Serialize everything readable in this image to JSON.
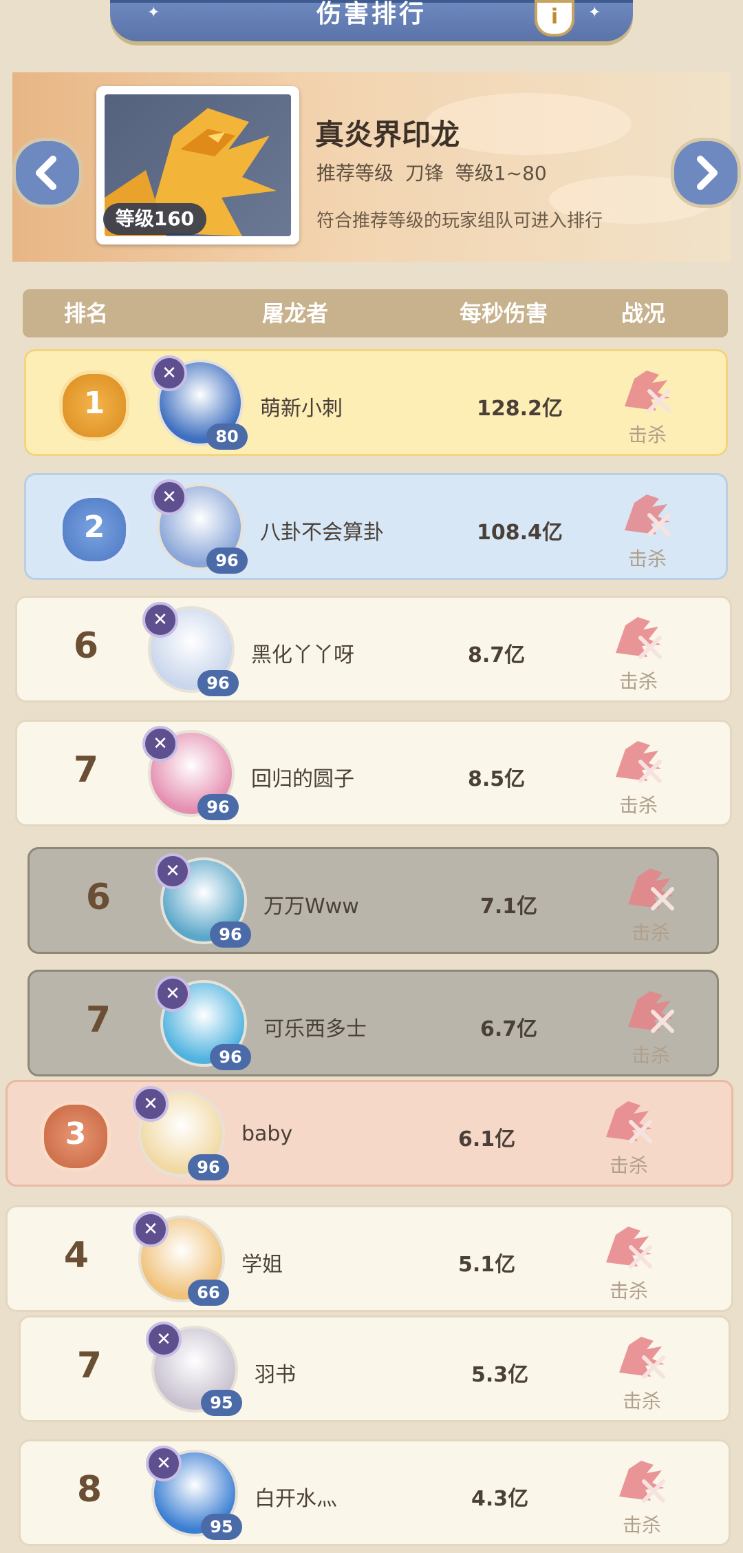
{
  "header": {
    "title": "伤害排行",
    "info_label": "i"
  },
  "boss": {
    "name": "真炎界印龙",
    "level_badge": "等级160",
    "subtitle": "推荐等级 刀锋  等级1~80",
    "rule": "符合推荐等级的玩家组队可进入排行",
    "prev_label": "<",
    "next_label": ">"
  },
  "columns": {
    "rank": "排名",
    "slayer": "屠龙者",
    "dps": "每秒伤害",
    "status": "战况"
  },
  "rows": [
    {
      "rank": "1",
      "medal": "gold",
      "name": "萌新小刺",
      "level": "80",
      "damage": "128.2亿",
      "status": "击杀",
      "avatar_color": "#3e6fc0"
    },
    {
      "rank": "2",
      "medal": "silver",
      "name": "八卦不会算卦",
      "level": "96",
      "damage": "108.4亿",
      "status": "击杀",
      "avatar_color": "#8aa6d8"
    },
    {
      "rank": "6",
      "medal": "",
      "name": "黑化丫丫呀",
      "level": "96",
      "damage": "8.7亿",
      "status": "击杀",
      "avatar_color": "#c9d6ec"
    },
    {
      "rank": "7",
      "medal": "",
      "name": "回归的圆子",
      "level": "96",
      "damage": "8.5亿",
      "status": "击杀",
      "avatar_color": "#e58fb0"
    },
    {
      "rank": "6",
      "medal": "",
      "name": "万万Www",
      "level": "96",
      "damage": "7.1亿",
      "status": "击杀",
      "avatar_color": "#5aa7c9"
    },
    {
      "rank": "7",
      "medal": "",
      "name": "可乐西多士",
      "level": "96",
      "damage": "6.7亿",
      "status": "击杀",
      "avatar_color": "#4fb3df"
    },
    {
      "rank": "3",
      "medal": "bronze",
      "name": "baby",
      "level": "96",
      "damage": "6.1亿",
      "status": "击杀",
      "avatar_color": "#f1d9a4"
    },
    {
      "rank": "4",
      "medal": "",
      "name": "学姐",
      "level": "66",
      "damage": "5.1亿",
      "status": "击杀",
      "avatar_color": "#f0c27a"
    },
    {
      "rank": "7",
      "medal": "",
      "name": "羽书",
      "level": "95",
      "damage": "5.3亿",
      "status": "击杀",
      "avatar_color": "#c8c2d0"
    },
    {
      "rank": "8",
      "medal": "",
      "name": "白开水灬",
      "level": "95",
      "damage": "4.3亿",
      "status": "击杀",
      "avatar_color": "#3b7ed3"
    }
  ],
  "colors": {
    "accent": "#6e89bf",
    "kill": "#e5848a"
  }
}
